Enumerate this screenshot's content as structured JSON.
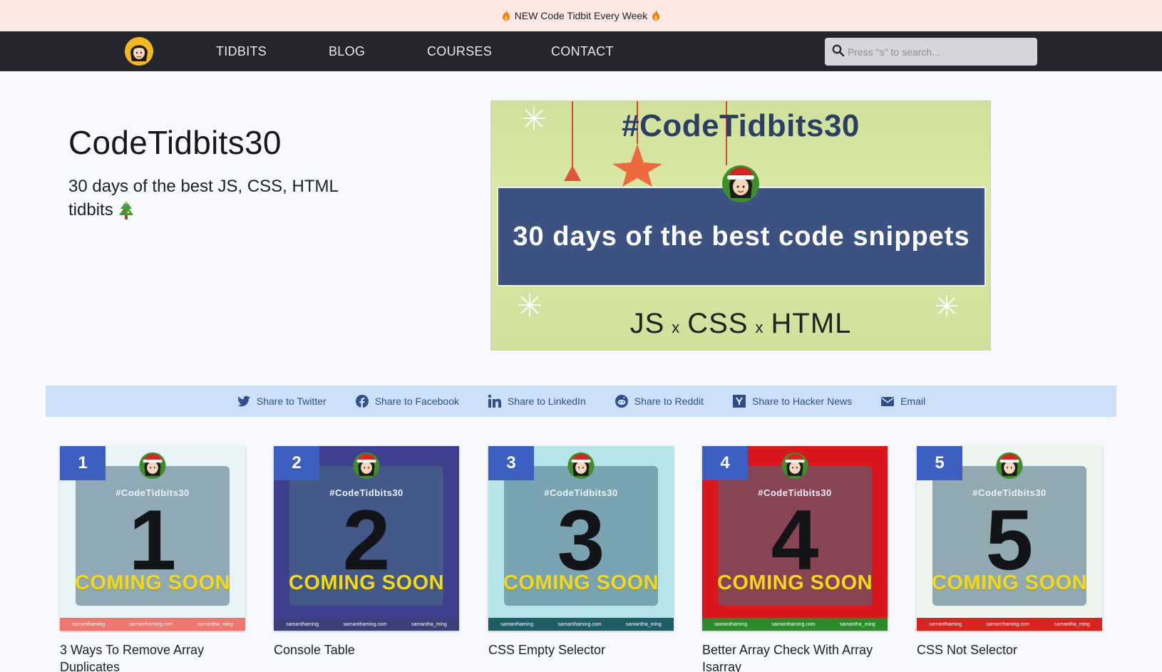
{
  "announcement": {
    "text": "NEW Code Tidbit Every Week"
  },
  "nav": {
    "links": [
      "TIDBITS",
      "BLOG",
      "COURSES",
      "CONTACT"
    ],
    "search_placeholder": "Press \"s\" to search..."
  },
  "hero": {
    "title": "CodeTidbits30",
    "subtitle": "30 days of the best JS, CSS, HTML tidbits",
    "banner": {
      "tag": "#CodeTidbits30",
      "headline": "30 days of the best code snippets",
      "langs": [
        "JS",
        "CSS",
        "HTML"
      ],
      "separator": "x"
    }
  },
  "share": [
    {
      "label": "Share to Twitter",
      "icon": "twitter-icon"
    },
    {
      "label": "Share to Facebook",
      "icon": "facebook-icon"
    },
    {
      "label": "Share to LinkedIn",
      "icon": "linkedin-icon"
    },
    {
      "label": "Share to Reddit",
      "icon": "reddit-icon"
    },
    {
      "label": "Share to Hacker News",
      "icon": "hacker-news-icon"
    },
    {
      "label": "Email",
      "icon": "email-icon"
    }
  ],
  "cards": [
    {
      "number": "1",
      "tag": "#CodeTidbits30",
      "status": "COMING SOON",
      "title": "3 Ways To Remove Array Duplicates",
      "bg": "#e9f4f6",
      "strip": "#f1766e"
    },
    {
      "number": "2",
      "tag": "#CodeTidbits30",
      "status": "COMING SOON",
      "title": "Console Table",
      "bg": "#3e3f8e",
      "strip": "#3a3f78"
    },
    {
      "number": "3",
      "tag": "#CodeTidbits30",
      "status": "COMING SOON",
      "title": "CSS Empty Selector",
      "bg": "#b7e6ea",
      "strip": "#1f5c66"
    },
    {
      "number": "4",
      "tag": "#CodeTidbits30",
      "status": "COMING SOON",
      "title": "Better Array Check With Array Isarray",
      "bg": "#d8161c",
      "strip": "#2d8a2b"
    },
    {
      "number": "5",
      "tag": "#CodeTidbits30",
      "status": "COMING SOON",
      "title": "CSS Not Selector",
      "bg": "#eef4ee",
      "strip": "#d8241f"
    }
  ],
  "card_strip": [
    "samanthaming",
    "samanthaming.com",
    "samantha_ming"
  ],
  "colors": {
    "nav": "#25262d",
    "announce": "#fde9e4",
    "share_bar": "#cde0fa",
    "accent": "#3b5fc3"
  }
}
